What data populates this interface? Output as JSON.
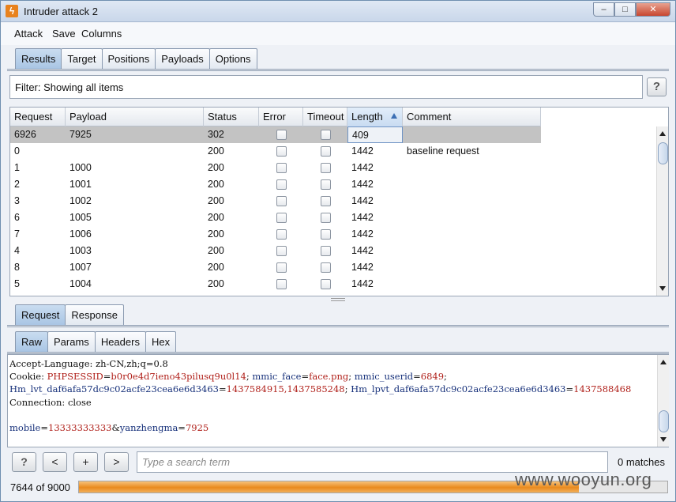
{
  "window": {
    "title": "Intruder attack 2",
    "app_icon": "burp-lightning-icon",
    "controls": [
      "minimize",
      "maximize",
      "close"
    ]
  },
  "menu": {
    "items": [
      "Attack",
      "Save",
      "Columns"
    ]
  },
  "main_tabs": {
    "items": [
      "Results",
      "Target",
      "Positions",
      "Payloads",
      "Options"
    ],
    "active": "Results"
  },
  "filter": {
    "text": "Filter: Showing all items",
    "help_label": "?"
  },
  "results_table": {
    "columns": [
      "Request",
      "Payload",
      "Status",
      "Error",
      "Timeout",
      "Length",
      "Comment"
    ],
    "sorted_column": "Length",
    "sort_direction": "ascending",
    "rows": [
      {
        "request": "6926",
        "payload": "7925",
        "status": "302",
        "error": false,
        "timeout": false,
        "length": "409",
        "comment": "",
        "selected": true
      },
      {
        "request": "0",
        "payload": "",
        "status": "200",
        "error": false,
        "timeout": false,
        "length": "1442",
        "comment": "baseline request",
        "selected": false
      },
      {
        "request": "1",
        "payload": "1000",
        "status": "200",
        "error": false,
        "timeout": false,
        "length": "1442",
        "comment": "",
        "selected": false
      },
      {
        "request": "2",
        "payload": "1001",
        "status": "200",
        "error": false,
        "timeout": false,
        "length": "1442",
        "comment": "",
        "selected": false
      },
      {
        "request": "3",
        "payload": "1002",
        "status": "200",
        "error": false,
        "timeout": false,
        "length": "1442",
        "comment": "",
        "selected": false
      },
      {
        "request": "6",
        "payload": "1005",
        "status": "200",
        "error": false,
        "timeout": false,
        "length": "1442",
        "comment": "",
        "selected": false
      },
      {
        "request": "7",
        "payload": "1006",
        "status": "200",
        "error": false,
        "timeout": false,
        "length": "1442",
        "comment": "",
        "selected": false
      },
      {
        "request": "4",
        "payload": "1003",
        "status": "200",
        "error": false,
        "timeout": false,
        "length": "1442",
        "comment": "",
        "selected": false
      },
      {
        "request": "8",
        "payload": "1007",
        "status": "200",
        "error": false,
        "timeout": false,
        "length": "1442",
        "comment": "",
        "selected": false
      },
      {
        "request": "5",
        "payload": "1004",
        "status": "200",
        "error": false,
        "timeout": false,
        "length": "1442",
        "comment": "",
        "selected": false
      }
    ]
  },
  "message_tabs": {
    "items": [
      "Request",
      "Response"
    ],
    "active": "Request"
  },
  "view_tabs": {
    "items": [
      "Raw",
      "Params",
      "Headers",
      "Hex"
    ],
    "active": "Raw"
  },
  "raw_lines": [
    [
      {
        "t": "Accept-Language: zh-CN,zh;q=0.8",
        "c": "k"
      }
    ],
    [
      {
        "t": "Cookie: ",
        "c": "k"
      },
      {
        "t": "PHPSESSID",
        "c": "v"
      },
      {
        "t": "=",
        "c": "k"
      },
      {
        "t": "b0r0e4d7ieno43pilusq9u0l14",
        "c": "v"
      },
      {
        "t": "; ",
        "c": "k"
      },
      {
        "t": "mmic_face",
        "c": "b"
      },
      {
        "t": "=",
        "c": "k"
      },
      {
        "t": "face.png",
        "c": "v"
      },
      {
        "t": "; ",
        "c": "k"
      },
      {
        "t": "mmic_userid",
        "c": "b"
      },
      {
        "t": "=",
        "c": "k"
      },
      {
        "t": "6849",
        "c": "v"
      },
      {
        "t": ";",
        "c": "k"
      }
    ],
    [
      {
        "t": "Hm_lvt_daf6afa57dc9c02acfe23cea6e6d3463",
        "c": "b"
      },
      {
        "t": "=",
        "c": "k"
      },
      {
        "t": "1437584915,1437585248",
        "c": "v"
      },
      {
        "t": "; ",
        "c": "k"
      },
      {
        "t": "Hm_lpvt_daf6afa57dc9c02acfe23cea6e6d3463",
        "c": "b"
      },
      {
        "t": "=",
        "c": "k"
      },
      {
        "t": "1437588468",
        "c": "v"
      }
    ],
    [
      {
        "t": "Connection: close",
        "c": "k"
      }
    ],
    [
      {
        "t": "",
        "c": "k"
      }
    ],
    [
      {
        "t": "mobile",
        "c": "b"
      },
      {
        "t": "=",
        "c": "k"
      },
      {
        "t": "13333333333",
        "c": "v"
      },
      {
        "t": "&",
        "c": "k"
      },
      {
        "t": "yanzhengma",
        "c": "b"
      },
      {
        "t": "=",
        "c": "k"
      },
      {
        "t": "7925",
        "c": "v"
      }
    ]
  ],
  "search": {
    "placeholder": "Type a search term",
    "help_label": "?",
    "prev_label": "<",
    "add_label": "+",
    "next_label": ">",
    "matches": "0 matches"
  },
  "progress": {
    "text": "7644 of 9000",
    "completed": 7644,
    "total": 9000
  },
  "watermark": "www.wooyun.org",
  "colors": {
    "accent": "#e98a1e",
    "tab_active": "#b5cde8",
    "selected_row": "#c3c3c3",
    "param_name": "#16307a",
    "param_value": "#b0201a"
  }
}
